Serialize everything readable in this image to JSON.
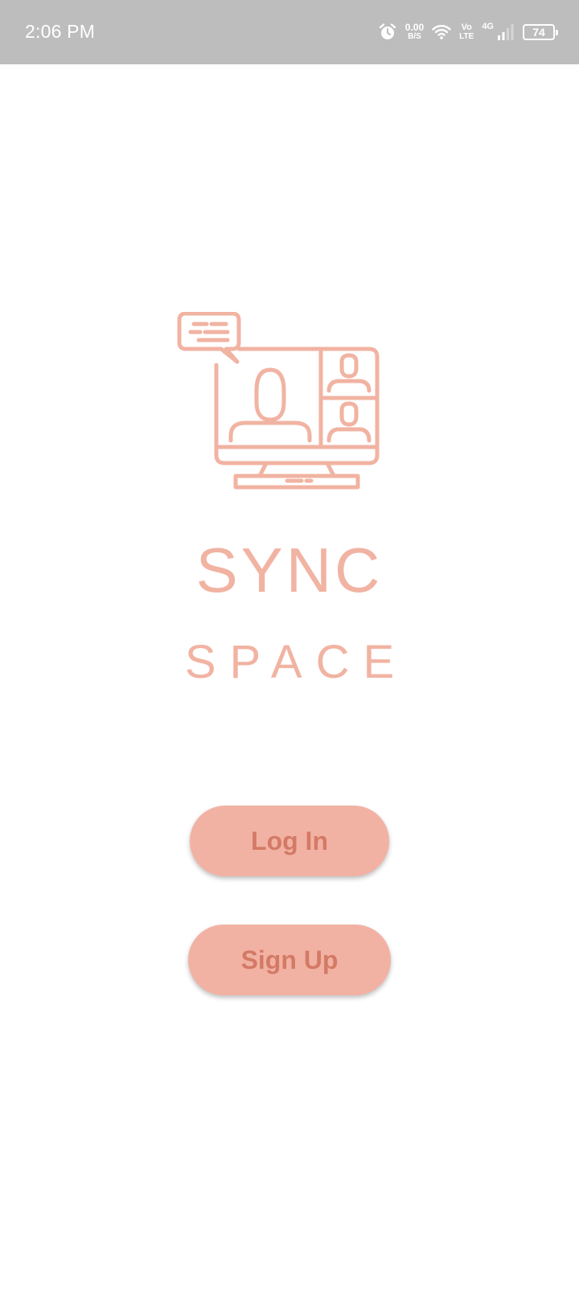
{
  "status_bar": {
    "time": "2:06 PM",
    "net_speed_value": "0.00",
    "net_speed_unit": "B/S",
    "volte_top": "Vo",
    "volte_bottom": "LTE",
    "network_type": "4G",
    "battery_level": "74",
    "icons": [
      "alarm-icon",
      "wifi-icon",
      "signal-icon",
      "battery-icon"
    ]
  },
  "brand": {
    "title_line1": "SYNC",
    "title_line2": "SPACE",
    "logo_icon": "video-conference-monitor-icon",
    "accent_color": "#f1b3a2"
  },
  "actions": {
    "login_label": "Log In",
    "signup_label": "Sign Up",
    "button_color": "#f2b2a3",
    "button_text_color": "#d37a66"
  }
}
